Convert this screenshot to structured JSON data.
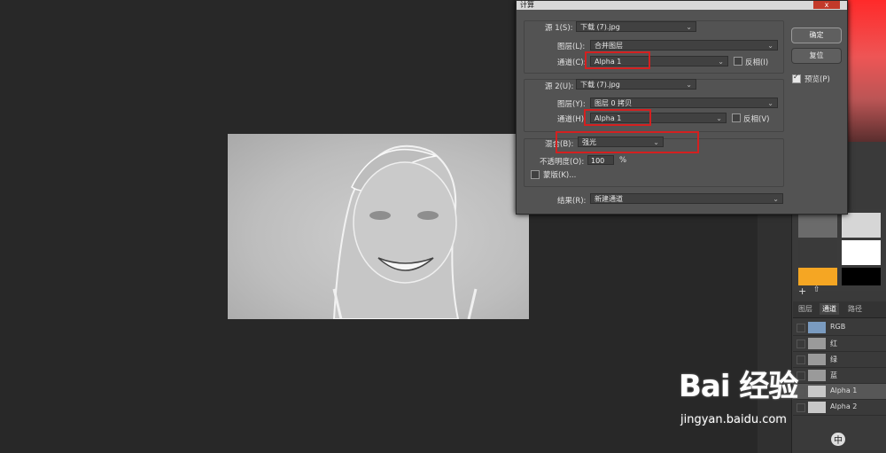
{
  "dialog": {
    "title": "计算",
    "close_label": "x",
    "source1": {
      "label": "源 1(S):",
      "file": "下载 (7).jpg",
      "layer_label": "图层(L):",
      "layer": "合并图层",
      "channel_label": "通道(C):",
      "channel": "Alpha 1",
      "invert_label": "反相(I)"
    },
    "source2": {
      "label": "源 2(U):",
      "file": "下载 (7).jpg",
      "layer_label": "图层(Y):",
      "layer": "图层 0 拷贝",
      "channel_label": "通道(H):",
      "channel": "Alpha 1",
      "invert_label": "反相(V)"
    },
    "blend": {
      "label": "混合(B):",
      "mode": "强光",
      "opacity_label": "不透明度(O):",
      "opacity": "100",
      "opacity_unit": "%",
      "mask_label": "蒙版(K)..."
    },
    "result": {
      "label": "结果(R):",
      "value": "新建通道"
    },
    "ok_label": "确定",
    "reset_label": "复位",
    "preview_label": "预览(P)",
    "preview_checked": true
  },
  "panels": {
    "tabs": [
      "图层",
      "通道",
      "路径"
    ],
    "active_tab": "通道",
    "channels": [
      {
        "label": "RGB"
      },
      {
        "label": "红"
      },
      {
        "label": "绿"
      },
      {
        "label": "蓝"
      },
      {
        "label": "Alpha 1"
      },
      {
        "label": "Alpha 2"
      }
    ],
    "selected_channel": "Alpha 1"
  },
  "colors": {
    "highlight_red": "#d42020",
    "swatch_gray1": "#6b6b6b",
    "swatch_gray2": "#d6d6d6",
    "swatch_dark": "#3a3a3a",
    "swatch_white": "#ffffff",
    "swatch_orange": "#f5a623",
    "swatch_black": "#000000"
  },
  "watermark": {
    "logo": "Bai 经验",
    "url": "jingyan.baidu.com",
    "badge": "中"
  }
}
